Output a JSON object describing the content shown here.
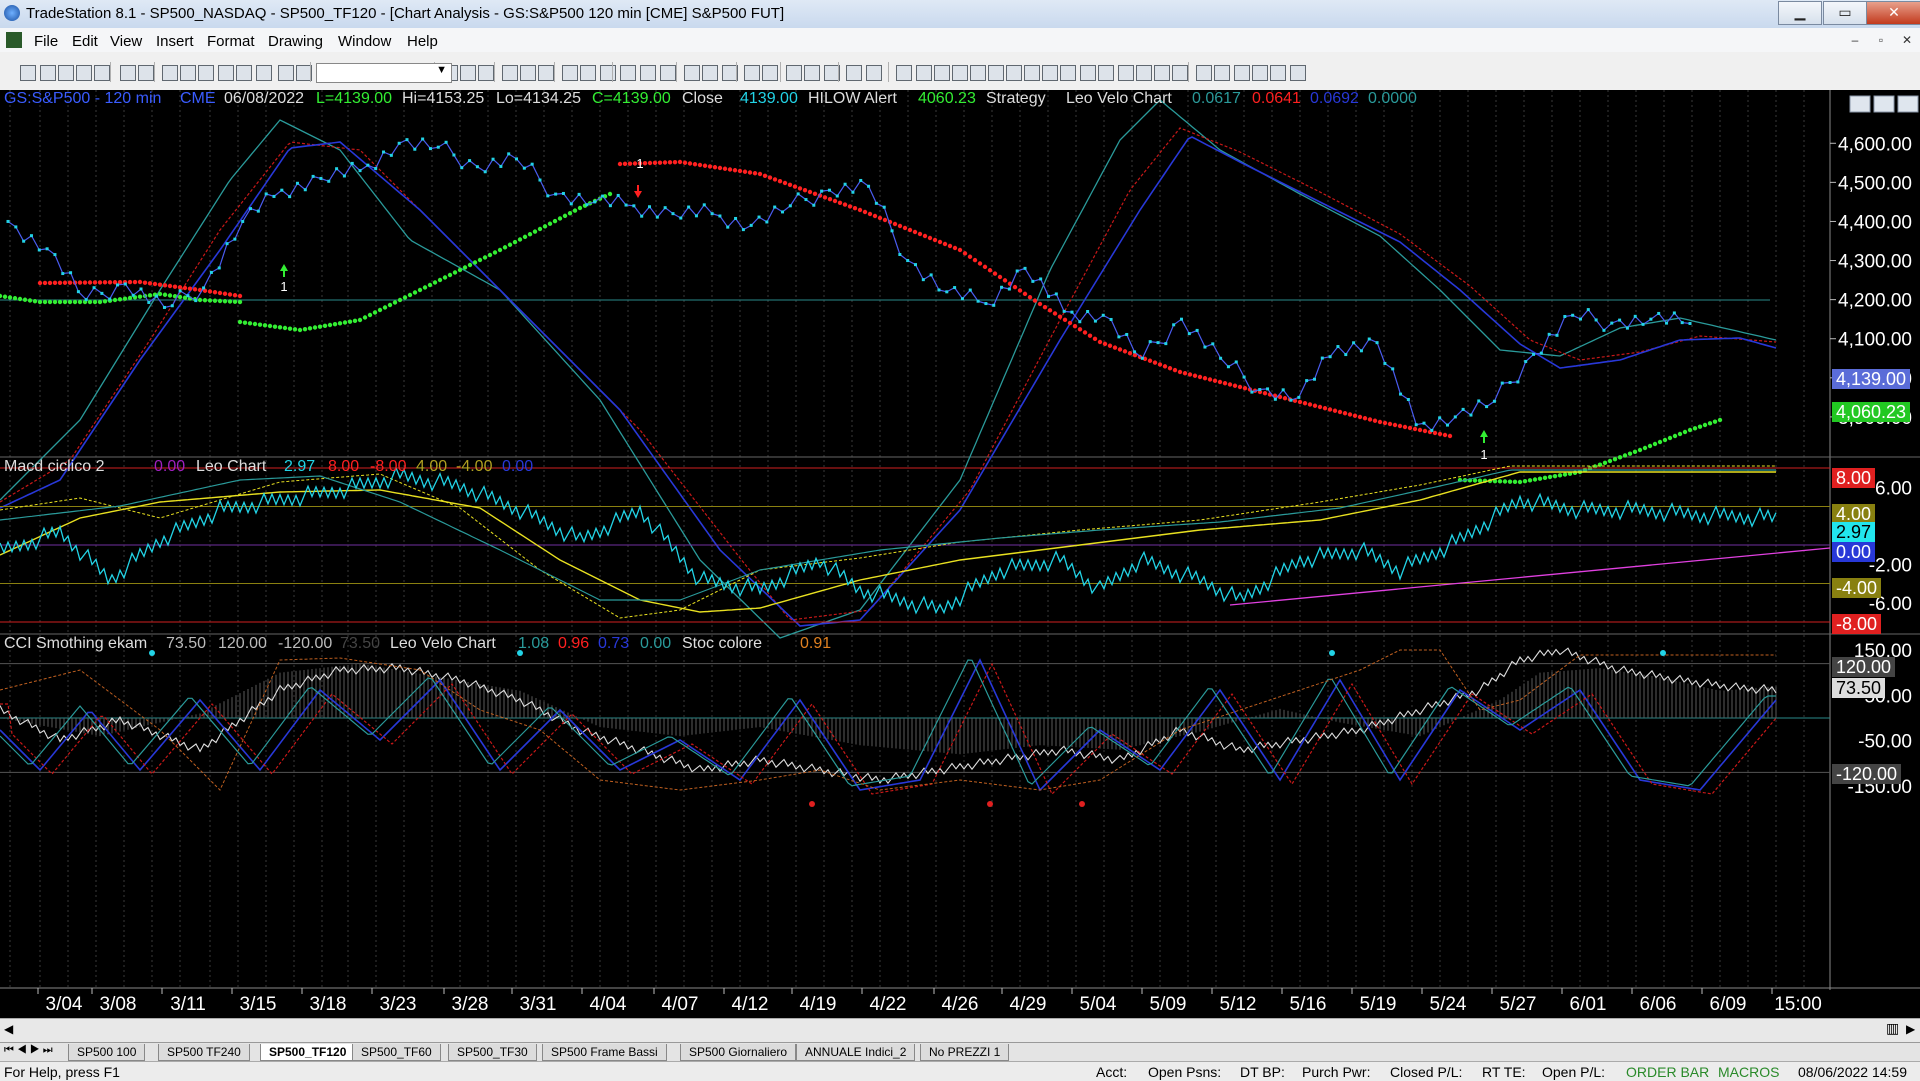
{
  "window": {
    "title": "TradeStation 8.1 - SP500_NASDAQ - SP500_TF120 - [Chart Analysis - GS:S&P500  120 min  [CME] S&P500 FUT]",
    "btn_min": "▁",
    "btn_max": "▭",
    "btn_close": "✕"
  },
  "menu": {
    "items": [
      "File",
      "Edit",
      "View",
      "Insert",
      "Format",
      "Drawing",
      "Window",
      "Help"
    ],
    "mdi_min": "–",
    "mdi_max": "▫",
    "mdi_close": "✕"
  },
  "pane1": {
    "symbol": "GS:S&P500 - 120 min",
    "exchange": "CME",
    "date": "06/08/2022",
    "last": "L=4139.00",
    "high": "Hi=4153.25",
    "low": "Lo=4134.25",
    "close_val": "C=4139.00",
    "close_label": "Close",
    "close_num": "4139.00",
    "hilow_label": "HILOW Alert",
    "hilow_num": "4060.23",
    "strategy": "Strategy",
    "leo_velo": "Leo Velo Chart",
    "v1": "0.0617",
    "v2": "0.0641",
    "v3": "0.0692",
    "v4": "0.0000",
    "yticks": [
      "4,600.00",
      "4,500.00",
      "4,400.00",
      "4,300.00",
      "4,200.00",
      "4,100.00",
      "4,000.00",
      "3,900.00"
    ],
    "tag_close": "4,139.00",
    "tag_hilow": "4,060.23",
    "signal": "1"
  },
  "pane2": {
    "title": "Macd ciclico 2",
    "v0": "0.00",
    "leo_chart": "Leo Chart",
    "v1": "2.97",
    "v2": "8.00",
    "v3": "-8.00",
    "v4": "4.00",
    "v5": "-4.00",
    "v6": "0.00",
    "yticks": [
      "6.00",
      "-2.00",
      "-6.00"
    ],
    "tag_8": "8.00",
    "tag_4": "4.00",
    "tag_297": "2.97",
    "tag_0": "0.00",
    "tag_m4": "-4.00",
    "tag_m8": "-8.00"
  },
  "pane3": {
    "title": "CCI Smothing ekam",
    "v1": "73.50",
    "v2": "120.00",
    "v3": "-120.00",
    "v4": "73.50",
    "leo_velo": "Leo Velo Chart",
    "c1": "1.08",
    "c2": "0.96",
    "c3": "0.73",
    "c4": "0.00",
    "stoc": "Stoc colore",
    "stoc_v": "0.91",
    "yticks": [
      "150.00",
      "50.00",
      "-50.00",
      "-150.00"
    ],
    "tag_120": "120.00",
    "tag_735": "73.50",
    "tag_m120": "-120.00"
  },
  "xaxis": [
    "3/04",
    "3/08",
    "3/11",
    "3/15",
    "3/18",
    "3/23",
    "3/28",
    "3/31",
    "4/04",
    "4/07",
    "4/12",
    "4/19",
    "4/22",
    "4/26",
    "4/29",
    "5/04",
    "5/09",
    "5/12",
    "5/16",
    "5/19",
    "5/24",
    "5/27",
    "6/01",
    "6/06",
    "6/09",
    "15:00"
  ],
  "tabs": [
    "SP500 100",
    "SP500 TF240",
    "SP500_TF120",
    "SP500_TF60",
    "SP500_TF30",
    "SP500 Frame Bassi",
    "SP500 Giornaliero",
    "ANNUALE Indici_2",
    "No PREZZI 1"
  ],
  "status": {
    "help": "For Help, press F1",
    "acct": "Acct:",
    "open_psns": "Open Psns:",
    "dt_bp": "DT BP:",
    "purch_pwr": "Purch Pwr:",
    "closed_pl": "Closed P/L:",
    "rt_te": "RT TE:",
    "open_pl": "Open P/L:",
    "order_bar": "ORDER BAR",
    "macros": "MACROS",
    "datetime": "08/06/2022 14:59"
  },
  "colors": {
    "price": "#22d3e6",
    "hilow_red": "#ff2020",
    "hilow_green": "#33ee33",
    "smooth_blue": "#2838d8",
    "smooth_red": "#c81818",
    "smooth_teal": "#2a9a9a",
    "yellow": "#e8e020",
    "magenta": "#e040e0"
  },
  "chart_data": {
    "type": "line",
    "title": "GS:S&P500 - 120 min",
    "ylim": [
      3800,
      4680
    ],
    "series": [
      {
        "name": "Close",
        "values": [
          4400,
          4330,
          4200,
          4240,
          4180,
          4230,
          4400,
          4480,
          4510,
          4530,
          4600,
          4590,
          4540,
          4560,
          4470,
          4450,
          4440,
          4420,
          4420,
          4390,
          4440,
          4480,
          4490,
          4300,
          4220,
          4190,
          4280,
          4170,
          4160,
          4050,
          4150,
          4050,
          3970,
          3950,
          4080,
          4090,
          3880,
          3900,
          3940,
          4060,
          4160,
          4140,
          4150,
          4139
        ]
      }
    ]
  }
}
